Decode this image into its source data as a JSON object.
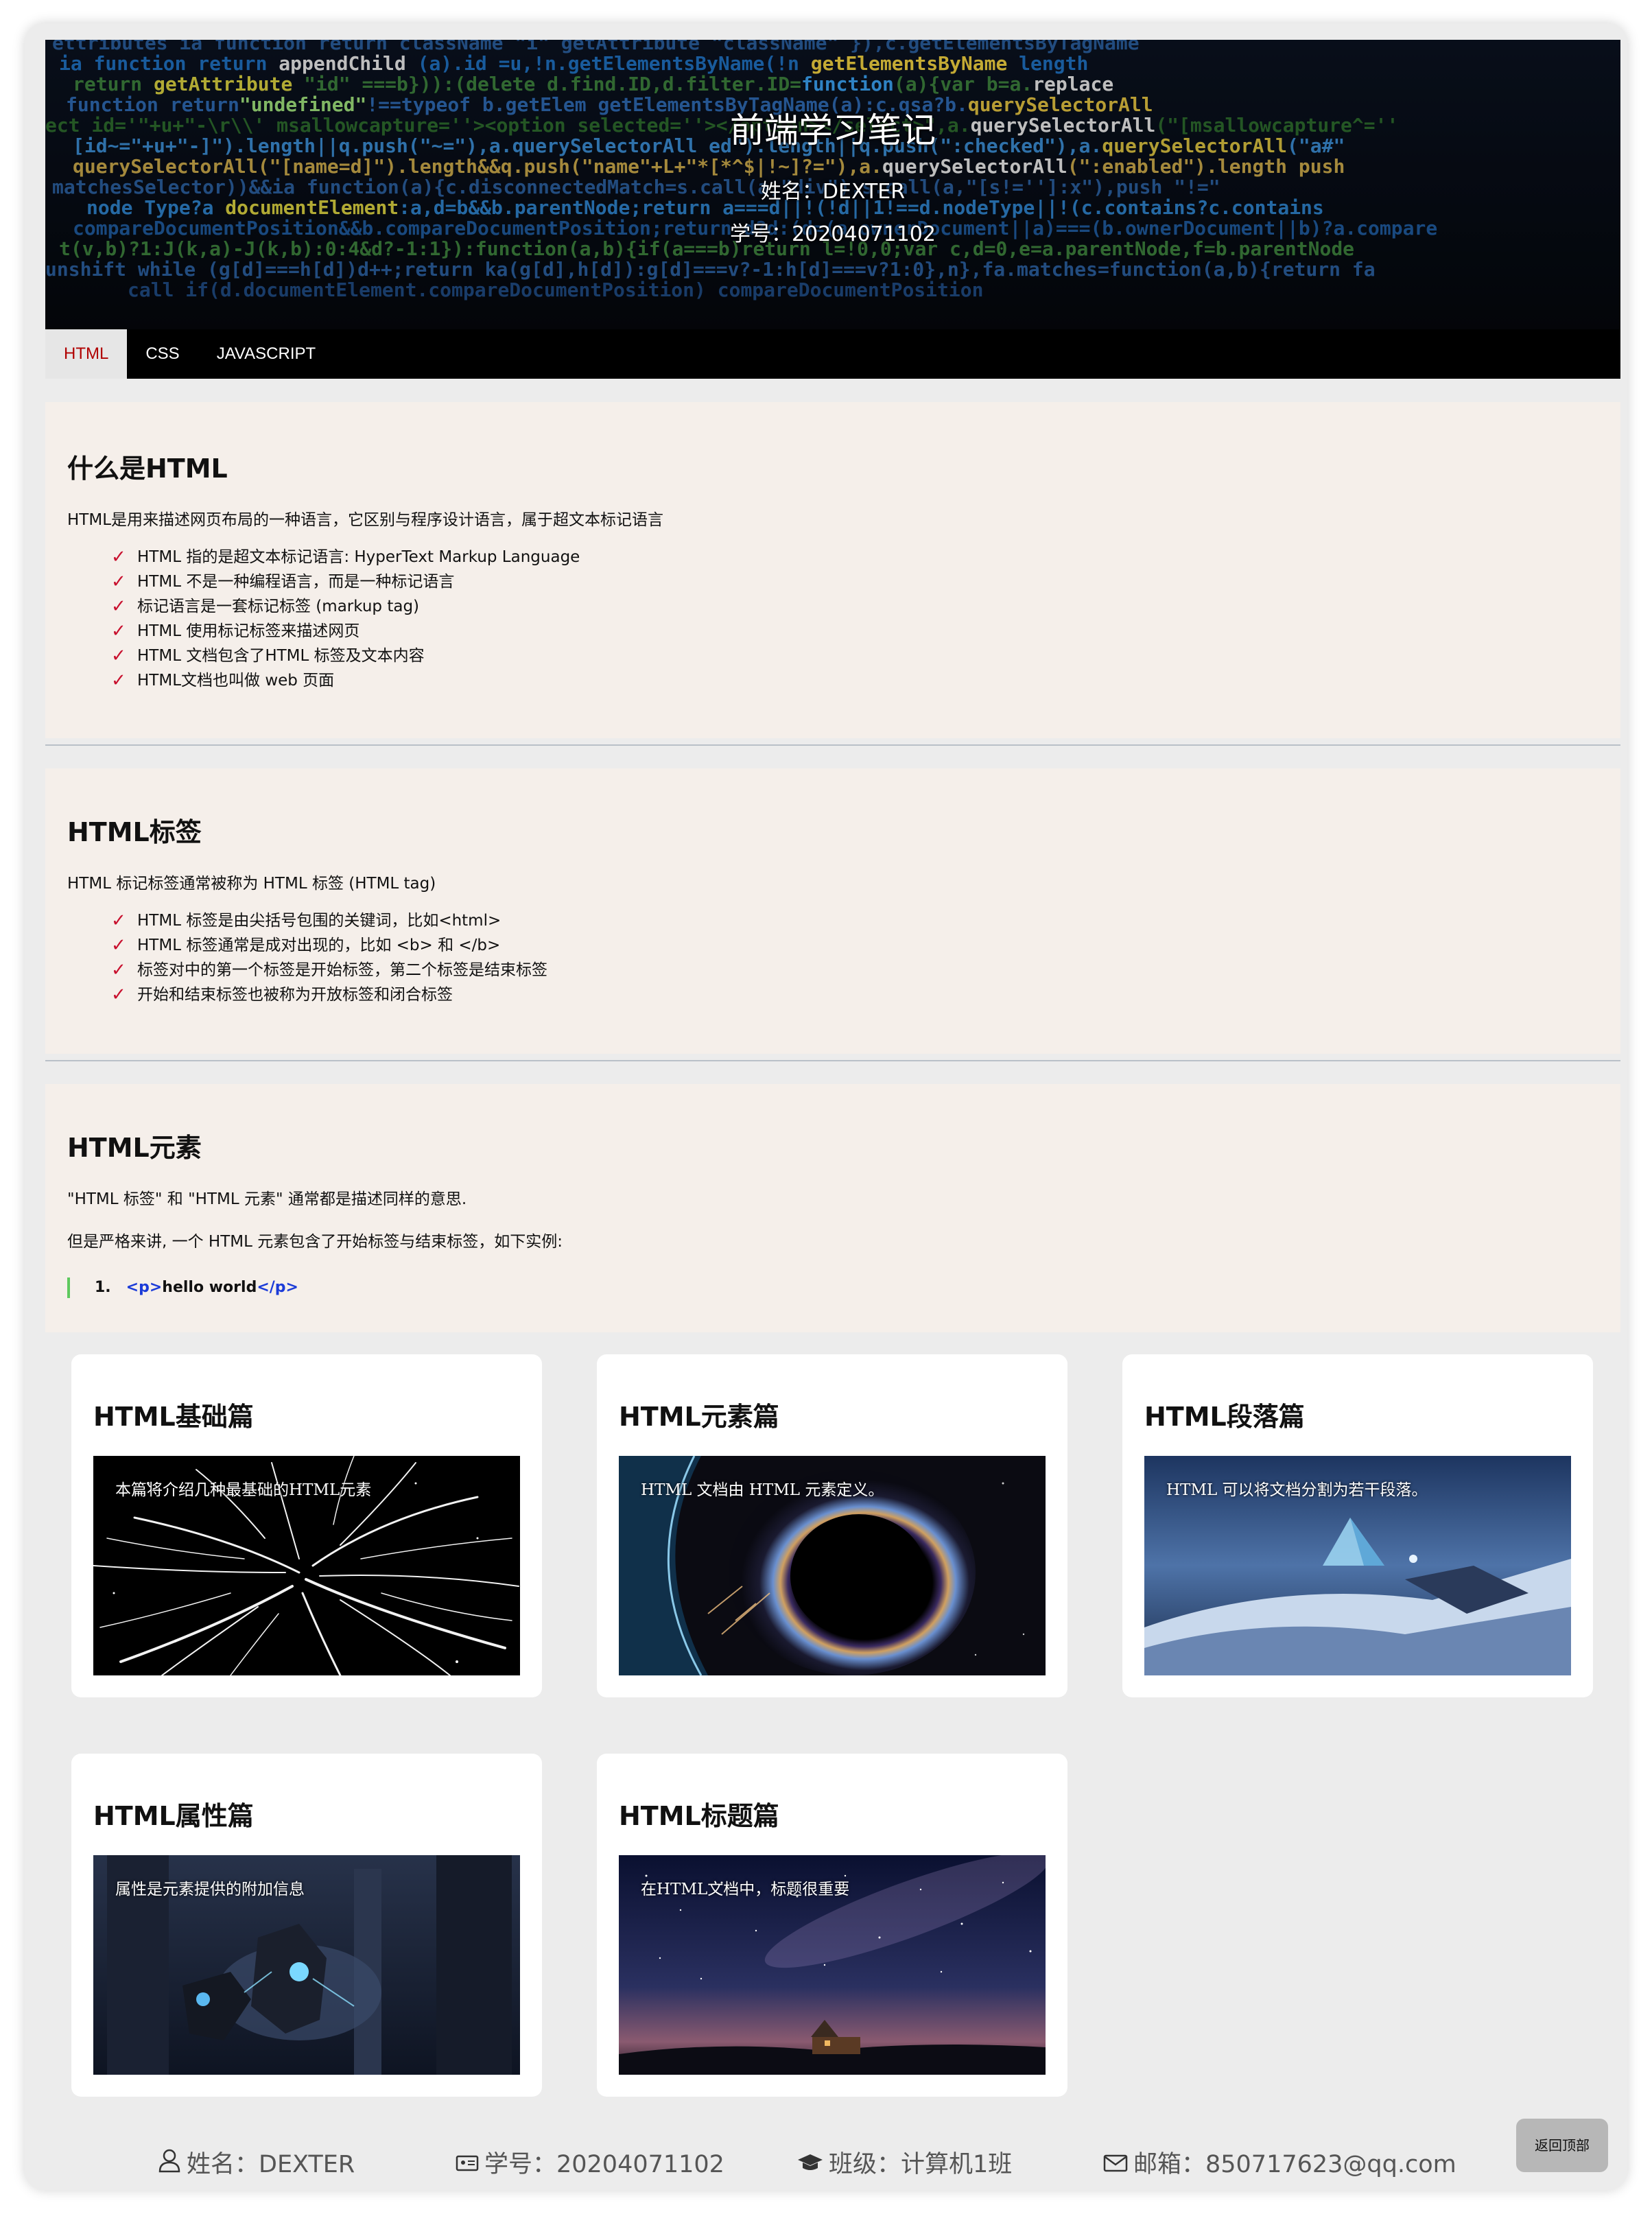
{
  "header": {
    "title": "前端学习笔记",
    "name": "姓名：DEXTER",
    "student_id": "学号：20204071102"
  },
  "nav": {
    "items": [
      "HTML",
      "CSS",
      "JAVASCRIPT"
    ],
    "active": "HTML"
  },
  "sections": [
    {
      "title": "什么是HTML",
      "desc": "HTML是用来描述网页布局的一种语言，它区别与程序设计语言，属于超文本标记语言",
      "items": [
        "HTML 指的是超文本标记语言: HyperText Markup Language",
        "HTML 不是一种编程语言，而是一种标记语言",
        "标记语言是一套标记标签 (markup tag)",
        "HTML 使用标记标签来描述网页",
        "HTML 文档包含了HTML 标签及文本内容",
        "HTML文档也叫做 web 页面"
      ]
    },
    {
      "title": "HTML标签",
      "desc": "HTML 标记标签通常被称为 HTML 标签 (HTML tag)",
      "items": [
        "HTML 标签是由尖括号包围的关键词，比如<html>",
        "HTML 标签通常是成对出现的，比如 <b> 和 </b>",
        "标签对中的第一个标签是开始标签，第二个标签是结束标签",
        "开始和结束标签也被称为开放标签和闭合标签"
      ]
    },
    {
      "title": "HTML元素",
      "desc1": "\"HTML 标签\" 和 \"HTML 元素\" 通常都是描述同样的意思.",
      "desc2": "但是严格来讲, 一个 HTML 元素包含了开始标签与结束标签，如下实例:",
      "code": {
        "line_no": "1.",
        "open_tag": "<p>",
        "text": "hello world",
        "close_tag": "</p>"
      }
    }
  ],
  "cards": [
    {
      "title": "HTML基础篇",
      "caption": "本篇将介绍几种最基础的HTML元素",
      "image": "warp-speed-stars"
    },
    {
      "title": "HTML元素篇",
      "caption": "HTML 文档由 HTML 元素定义。",
      "image": "planet-eclipse"
    },
    {
      "title": "HTML段落篇",
      "caption": "HTML 可以将文档分割为若干段落。",
      "image": "icy-pyramid-landscape"
    },
    {
      "title": "HTML属性篇",
      "caption": "属性是元素提供的附加信息",
      "image": "sci-fi-robot-fight"
    },
    {
      "title": "HTML标题篇",
      "caption": "在HTML文档中，标题很重要",
      "image": "starry-night-church"
    }
  ],
  "footer": {
    "name": "姓名：DEXTER",
    "student_id": "学号：20204071102",
    "class": "班级：计算机1班",
    "email": "邮箱：850717623@qq.com"
  },
  "back_to_top": "返回顶部",
  "colors": {
    "nav_active_text": "#b00000",
    "check": "#c8102e",
    "code_tag": "#1b3bd8",
    "code_border": "#5ec95e",
    "section_bg": "#f5efea"
  }
}
